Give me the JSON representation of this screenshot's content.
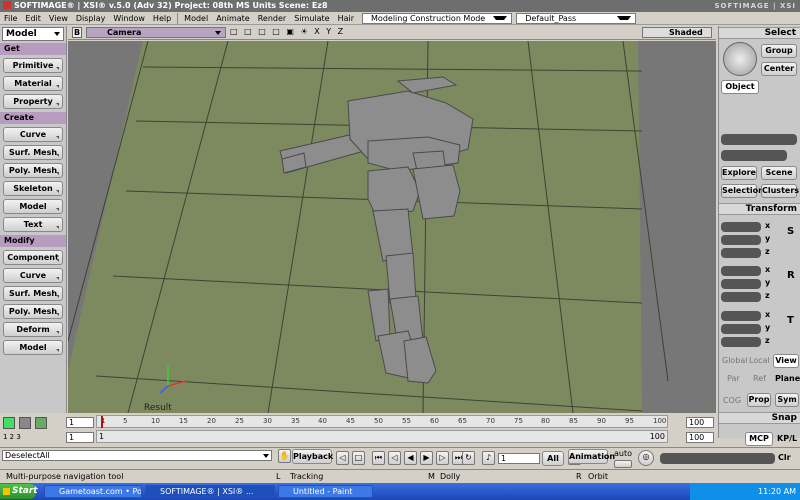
{
  "title": {
    "text": "SOFTIMAGE® | XSI® v.5.0 (Adv 32) Project: 08th MS Units    Scene: Ez8",
    "brand": "SOFTIMAGE | XSI"
  },
  "menu": {
    "items": [
      "File",
      "Edit",
      "View",
      "Display",
      "Window",
      "Help",
      "Model",
      "Animate",
      "Render",
      "Simulate",
      "Hair"
    ],
    "construction_mode": "Modeling Construction Mode",
    "pass": "Default_Pass"
  },
  "left": {
    "mode": "Model",
    "get_label": "Get",
    "get_items": [
      "Primitive",
      "Material",
      "Property"
    ],
    "create_label": "Create",
    "create_items": [
      "Curve",
      "Surf. Mesh",
      "Poly. Mesh",
      "Skeleton",
      "Model",
      "Text"
    ],
    "modify_label": "Modify",
    "modify_items": [
      "Component",
      "Curve",
      "Surf. Mesh",
      "Poly. Mesh",
      "Deform",
      "Model"
    ]
  },
  "viewport": {
    "view_letter": "B",
    "camera": "Camera",
    "tools": "□ □ □ □ ▣  ☀ X Y Z",
    "shading": "Shaded",
    "result": "Result"
  },
  "right": {
    "select_label": "Select",
    "group": "Group",
    "center": "Center",
    "object": "Object",
    "explore": "Explore",
    "scene": "Scene",
    "selection": "Selection",
    "clusters": "Clusters",
    "transform_label": "Transform",
    "global": "Global",
    "local": "Local",
    "view": "View",
    "par": "Par",
    "ref": "Ref",
    "plane": "Plane",
    "cog": "COG",
    "prop": "Prop",
    "sym": "Sym",
    "snap_label": "Snap",
    "mcp": "MCP",
    "kpl": "KP/L",
    "axes": [
      "x",
      "y",
      "z"
    ],
    "s_label": "S",
    "r_label": "R",
    "t_label": "T"
  },
  "timeline": {
    "start": "1",
    "start2": "1",
    "end": "100",
    "end2": "100",
    "ticks": [
      "1",
      "5",
      "10",
      "15",
      "20",
      "25",
      "30",
      "35",
      "40",
      "45",
      "50",
      "55",
      "60",
      "65",
      "70",
      "75",
      "80",
      "85",
      "90",
      "95",
      "100"
    ],
    "lower_left": "1",
    "lower_right": "100",
    "icon_label": "1 2 3"
  },
  "command": {
    "value": "DeselectAll",
    "playback": "Playback",
    "frame": "1",
    "all": "All",
    "animation": "Animation",
    "auto": "auto",
    "clr": "Clr"
  },
  "status": {
    "message": "Multi-purpose navigation tool",
    "l_key": "L",
    "l_action": "Tracking",
    "m_key": "M",
    "m_action": "Dolly",
    "r_key": "R",
    "r_action": "Orbit"
  },
  "taskbar": {
    "start": "Start",
    "tasks": [
      "Gametoast.com • Post a ...",
      "SOFTIMAGE® | XSI® ...",
      "Untitled - Paint"
    ],
    "time": "11:20 AM"
  },
  "colors": {
    "viewport_floor": "#7d8a60",
    "viewport_bg": "#7a7a7a",
    "section_purple": "#b89cc0",
    "grid_line": "#3d4433"
  }
}
